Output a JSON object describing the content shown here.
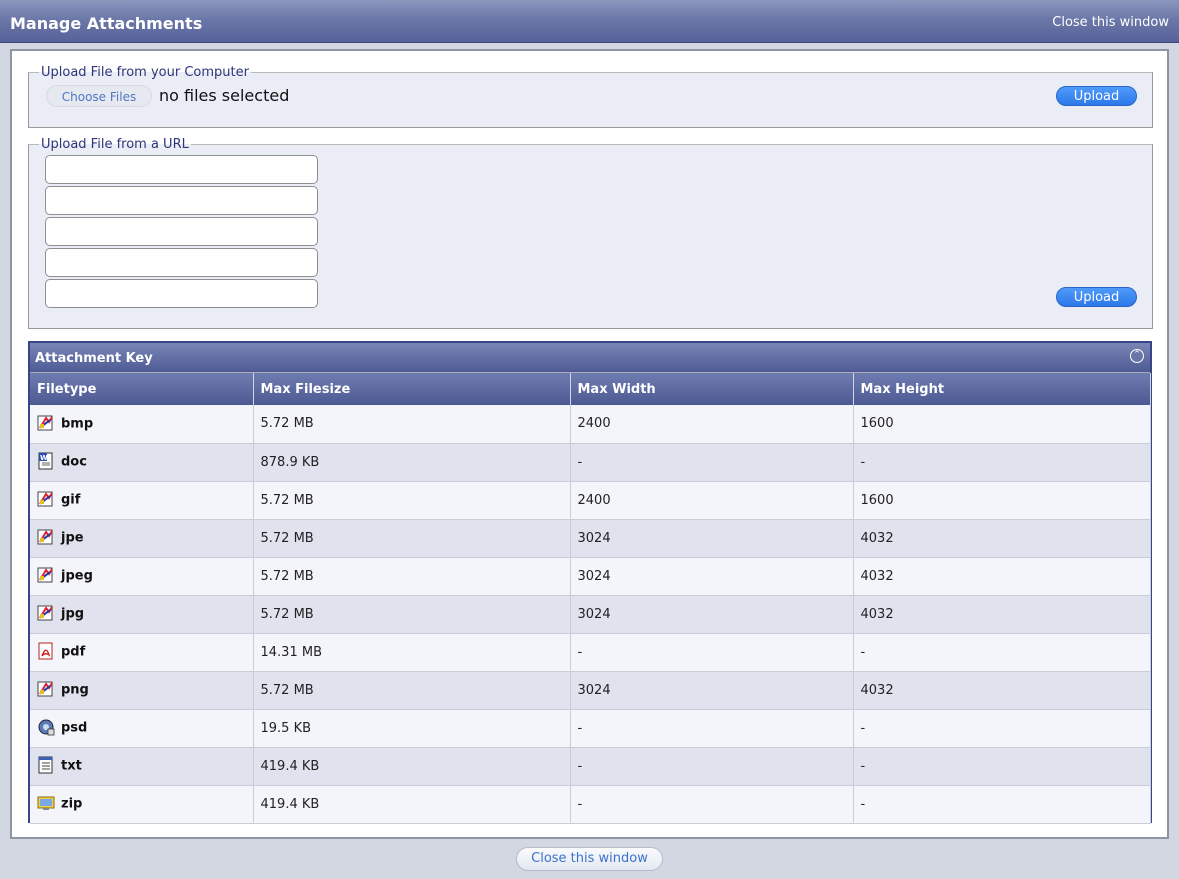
{
  "window": {
    "title": "Manage Attachments",
    "close_top_label": "Close this window",
    "close_bottom_label": "Close this window"
  },
  "upload_computer": {
    "legend": "Upload File from your Computer",
    "choose_label": "Choose Files",
    "status_text": "no files selected",
    "upload_label": "Upload"
  },
  "upload_url": {
    "legend": "Upload File from a URL",
    "inputs": [
      {
        "value": "",
        "placeholder": ""
      },
      {
        "value": "",
        "placeholder": ""
      },
      {
        "value": "",
        "placeholder": ""
      },
      {
        "value": "",
        "placeholder": ""
      },
      {
        "value": "",
        "placeholder": ""
      }
    ],
    "upload_label": "Upload"
  },
  "attachment_key": {
    "title": "Attachment Key",
    "columns": [
      "Filetype",
      "Max Filesize",
      "Max Width",
      "Max Height"
    ],
    "rows": [
      {
        "type": "bmp",
        "icon": "image-icon",
        "size": "5.72 MB",
        "width": "2400",
        "height": "1600"
      },
      {
        "type": "doc",
        "icon": "word-document-icon",
        "size": "878.9 KB",
        "width": "-",
        "height": "-"
      },
      {
        "type": "gif",
        "icon": "image-icon",
        "size": "5.72 MB",
        "width": "2400",
        "height": "1600"
      },
      {
        "type": "jpe",
        "icon": "image-icon",
        "size": "5.72 MB",
        "width": "3024",
        "height": "4032"
      },
      {
        "type": "jpeg",
        "icon": "image-icon",
        "size": "5.72 MB",
        "width": "3024",
        "height": "4032"
      },
      {
        "type": "jpg",
        "icon": "image-icon",
        "size": "5.72 MB",
        "width": "3024",
        "height": "4032"
      },
      {
        "type": "pdf",
        "icon": "pdf-icon",
        "size": "14.31 MB",
        "width": "-",
        "height": "-"
      },
      {
        "type": "png",
        "icon": "image-icon",
        "size": "5.72 MB",
        "width": "3024",
        "height": "4032"
      },
      {
        "type": "psd",
        "icon": "psd-icon",
        "size": "19.5 KB",
        "width": "-",
        "height": "-"
      },
      {
        "type": "txt",
        "icon": "text-file-icon",
        "size": "419.4 KB",
        "width": "-",
        "height": "-"
      },
      {
        "type": "zip",
        "icon": "zip-archive-icon",
        "size": "419.4 KB",
        "width": "-",
        "height": "-"
      }
    ]
  },
  "colors": {
    "titlebar": "#6c78a8",
    "accent_button": "#2c78ea",
    "table_header": "#4d5992"
  }
}
